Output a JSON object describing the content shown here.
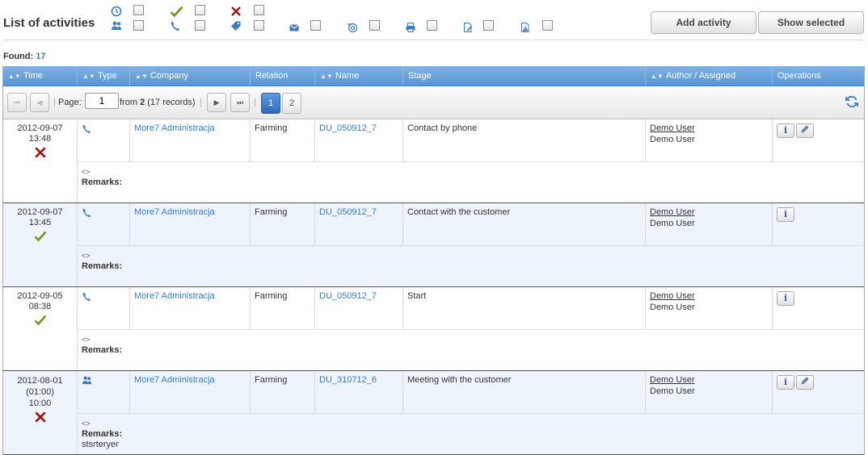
{
  "header": {
    "title": "List of activities",
    "add_activity": "Add activity",
    "show_selected": "Show selected"
  },
  "filters": [
    {
      "icon": "clock-icon"
    },
    {
      "icon": "meeting-icon"
    },
    {
      "icon": "check-icon"
    },
    {
      "icon": "phone-icon"
    },
    {
      "icon": "x-icon"
    },
    {
      "icon": "tag-icon"
    },
    {
      "icon": "envelope-icon"
    },
    {
      "icon": "at-icon"
    },
    {
      "icon": "printer-icon"
    },
    {
      "icon": "document-edit-icon"
    },
    {
      "icon": "document-warning-icon"
    }
  ],
  "found": {
    "label": "Found:",
    "count": "17"
  },
  "columns": [
    "Time",
    "Type",
    "Company",
    "Relation",
    "Name",
    "Stage",
    "Author / Assigned",
    "Operations"
  ],
  "pager": {
    "page_label": "Page:",
    "page_value": "1",
    "from_text": "from",
    "total_pages": "2",
    "records_text": "(17 records)",
    "pages": [
      "1",
      "2"
    ]
  },
  "rows": [
    {
      "date": "2012-09-07",
      "extra": "",
      "time": "13:48",
      "status": "x",
      "type_icon": "phone-icon",
      "company": "More7 Administracja",
      "relation": "Farming",
      "name": "DU_050912_7",
      "stage": "Contact by phone",
      "author": "Demo User",
      "assigned": "Demo User",
      "remarks_prefix": "<>",
      "remarks_label": "Remarks:",
      "remarks_text": "",
      "ops": [
        "info",
        "edit"
      ]
    },
    {
      "date": "2012-09-07",
      "extra": "",
      "time": "13:45",
      "status": "check",
      "type_icon": "phone-icon",
      "company": "More7 Administracja",
      "relation": "Farming",
      "name": "DU_050912_7",
      "stage": "Contact with the customer",
      "author": "Demo User",
      "assigned": "Demo User",
      "remarks_prefix": "<>",
      "remarks_label": "Remarks:",
      "remarks_text": "",
      "ops": [
        "info"
      ]
    },
    {
      "date": "2012-09-05",
      "extra": "",
      "time": "08:38",
      "status": "check",
      "type_icon": "phone-icon",
      "company": "More7 Administracja",
      "relation": "Farming",
      "name": "DU_050912_7",
      "stage": "Start",
      "author": "Demo User",
      "assigned": "Demo User",
      "remarks_prefix": "<>",
      "remarks_label": "Remarks:",
      "remarks_text": "",
      "ops": [
        "info"
      ]
    },
    {
      "date": "2012-08-01",
      "extra": "(01:00)",
      "time": "10:00",
      "status": "x",
      "type_icon": "meeting-icon",
      "company": "More7 Administracja",
      "relation": "Farming",
      "name": "DU_310712_6",
      "stage": "Meeting with the customer",
      "author": "Demo User",
      "assigned": "Demo User",
      "remarks_prefix": "<>",
      "remarks_label": "Remarks:",
      "remarks_text": "stsrteryer",
      "ops": [
        "info",
        "edit"
      ]
    }
  ],
  "colors": {
    "accent": "#5a95d3",
    "link": "#3b7dc0",
    "check": "#6a9a16",
    "x": "#a01515"
  }
}
